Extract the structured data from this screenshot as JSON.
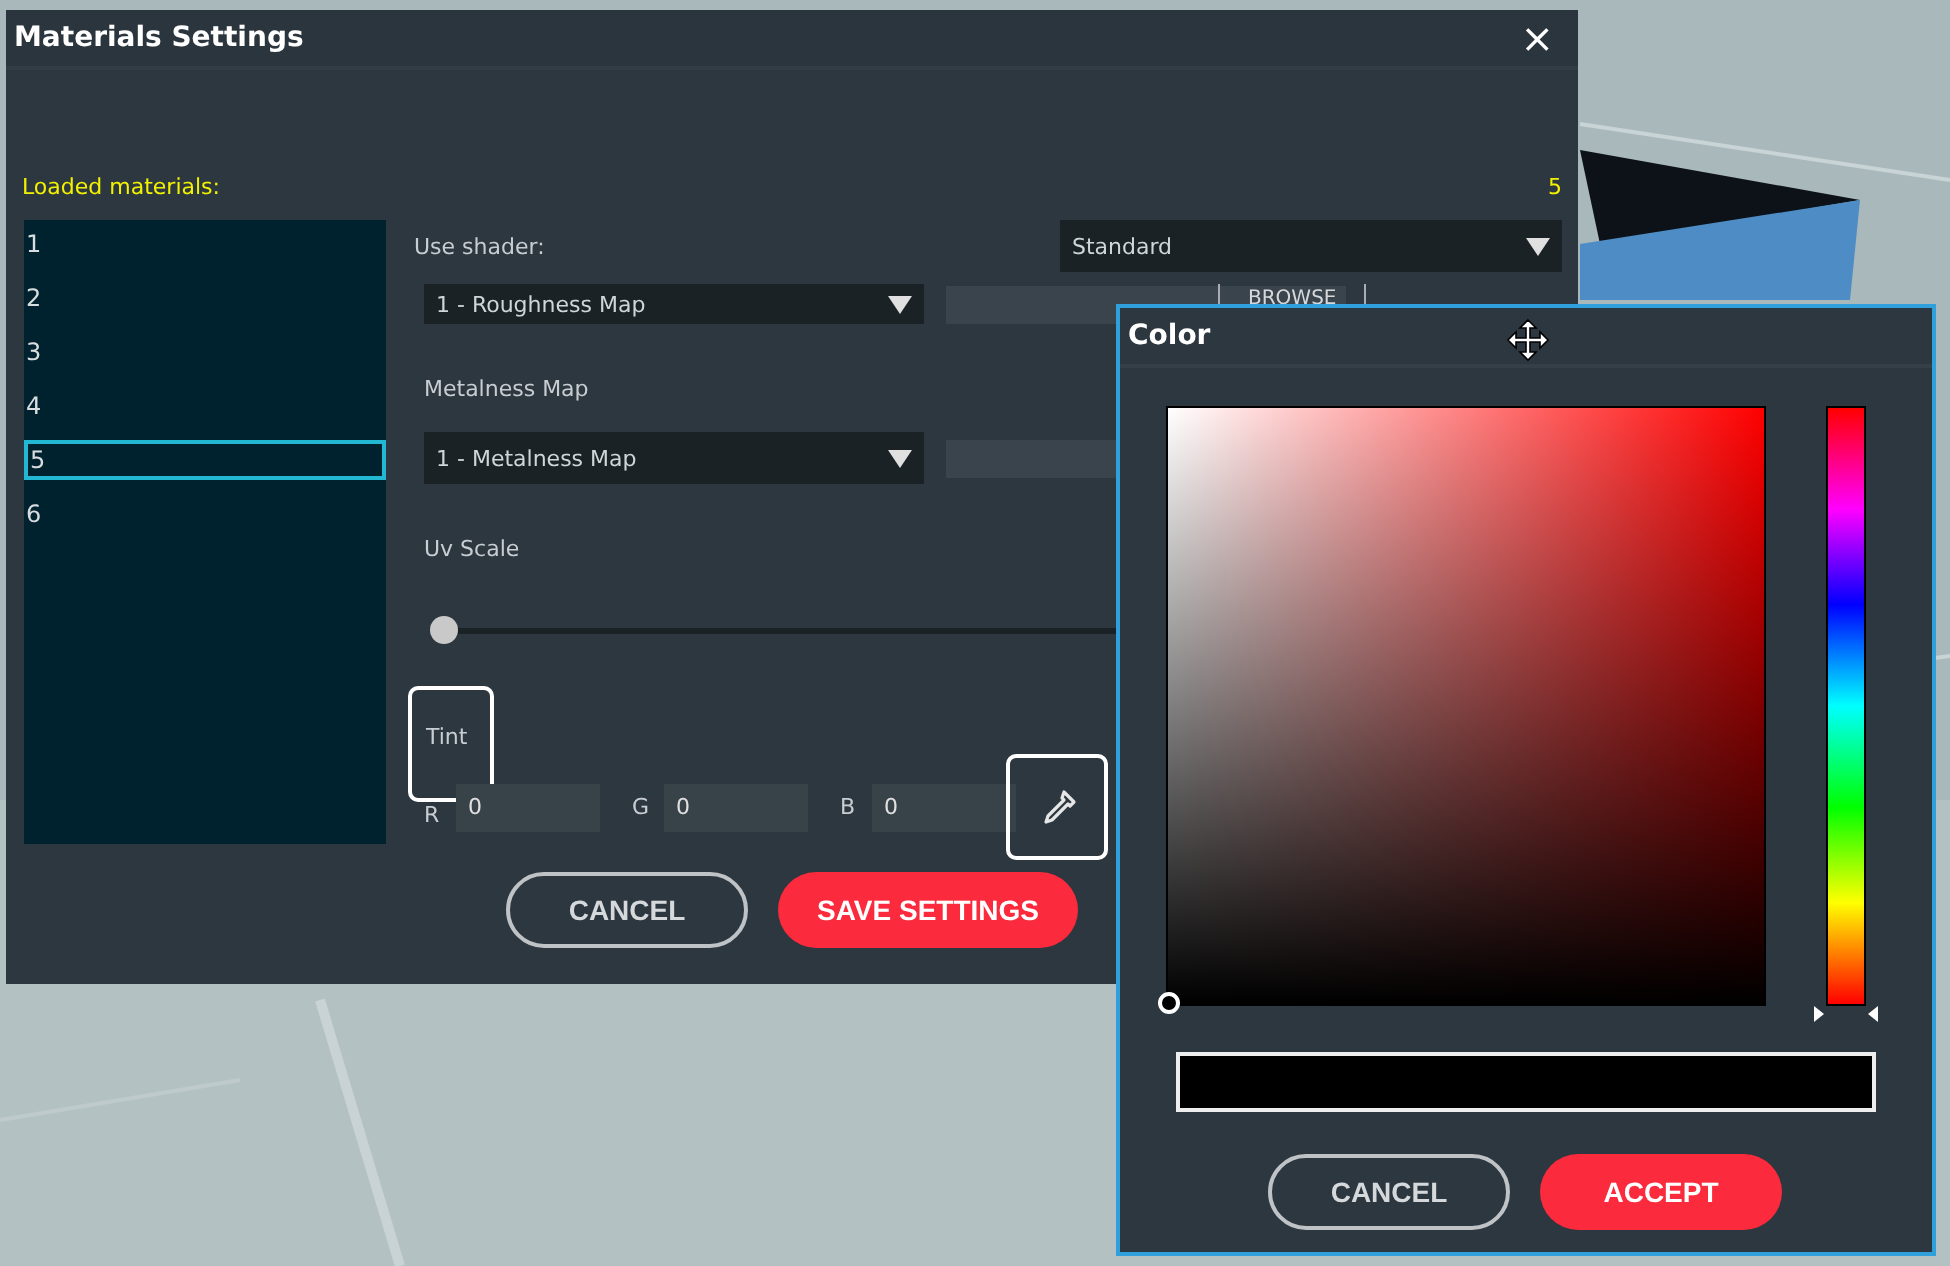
{
  "window": {
    "title": "Materials Settings",
    "close": "×"
  },
  "materials": {
    "label": "Loaded materials:",
    "count": "5",
    "items": [
      {
        "label": "1",
        "selected": false
      },
      {
        "label": "2",
        "selected": false
      },
      {
        "label": "3",
        "selected": false
      },
      {
        "label": "4",
        "selected": false
      },
      {
        "label": "5",
        "selected": true
      },
      {
        "label": "6",
        "selected": false
      }
    ]
  },
  "shader": {
    "label": "Use shader:",
    "value": "Standard"
  },
  "roughness": {
    "value": "1 - Roughness Map",
    "browse": "BROWSE"
  },
  "metalness": {
    "label": "Metalness Map",
    "value": "1 - Metalness Map"
  },
  "uv_scale": {
    "label": "Uv Scale",
    "level": 0
  },
  "tint": {
    "label": "Tint",
    "focused": true,
    "channels": [
      {
        "label": "R",
        "value": "0"
      },
      {
        "label": "G",
        "value": "0"
      },
      {
        "label": "B",
        "value": "0"
      }
    ],
    "eyedropper_focused": true
  },
  "buttons": [
    {
      "label": "CANCEL",
      "kind": "outline"
    },
    {
      "label": "SAVE SETTINGS",
      "kind": "primary"
    }
  ],
  "color_dialog": {
    "title": "Color",
    "hue": {
      "level": 0
    },
    "buttons": [
      {
        "label": "CANCEL",
        "kind": "outline"
      },
      {
        "label": "ACCEPT",
        "kind": "primary"
      }
    ]
  }
}
